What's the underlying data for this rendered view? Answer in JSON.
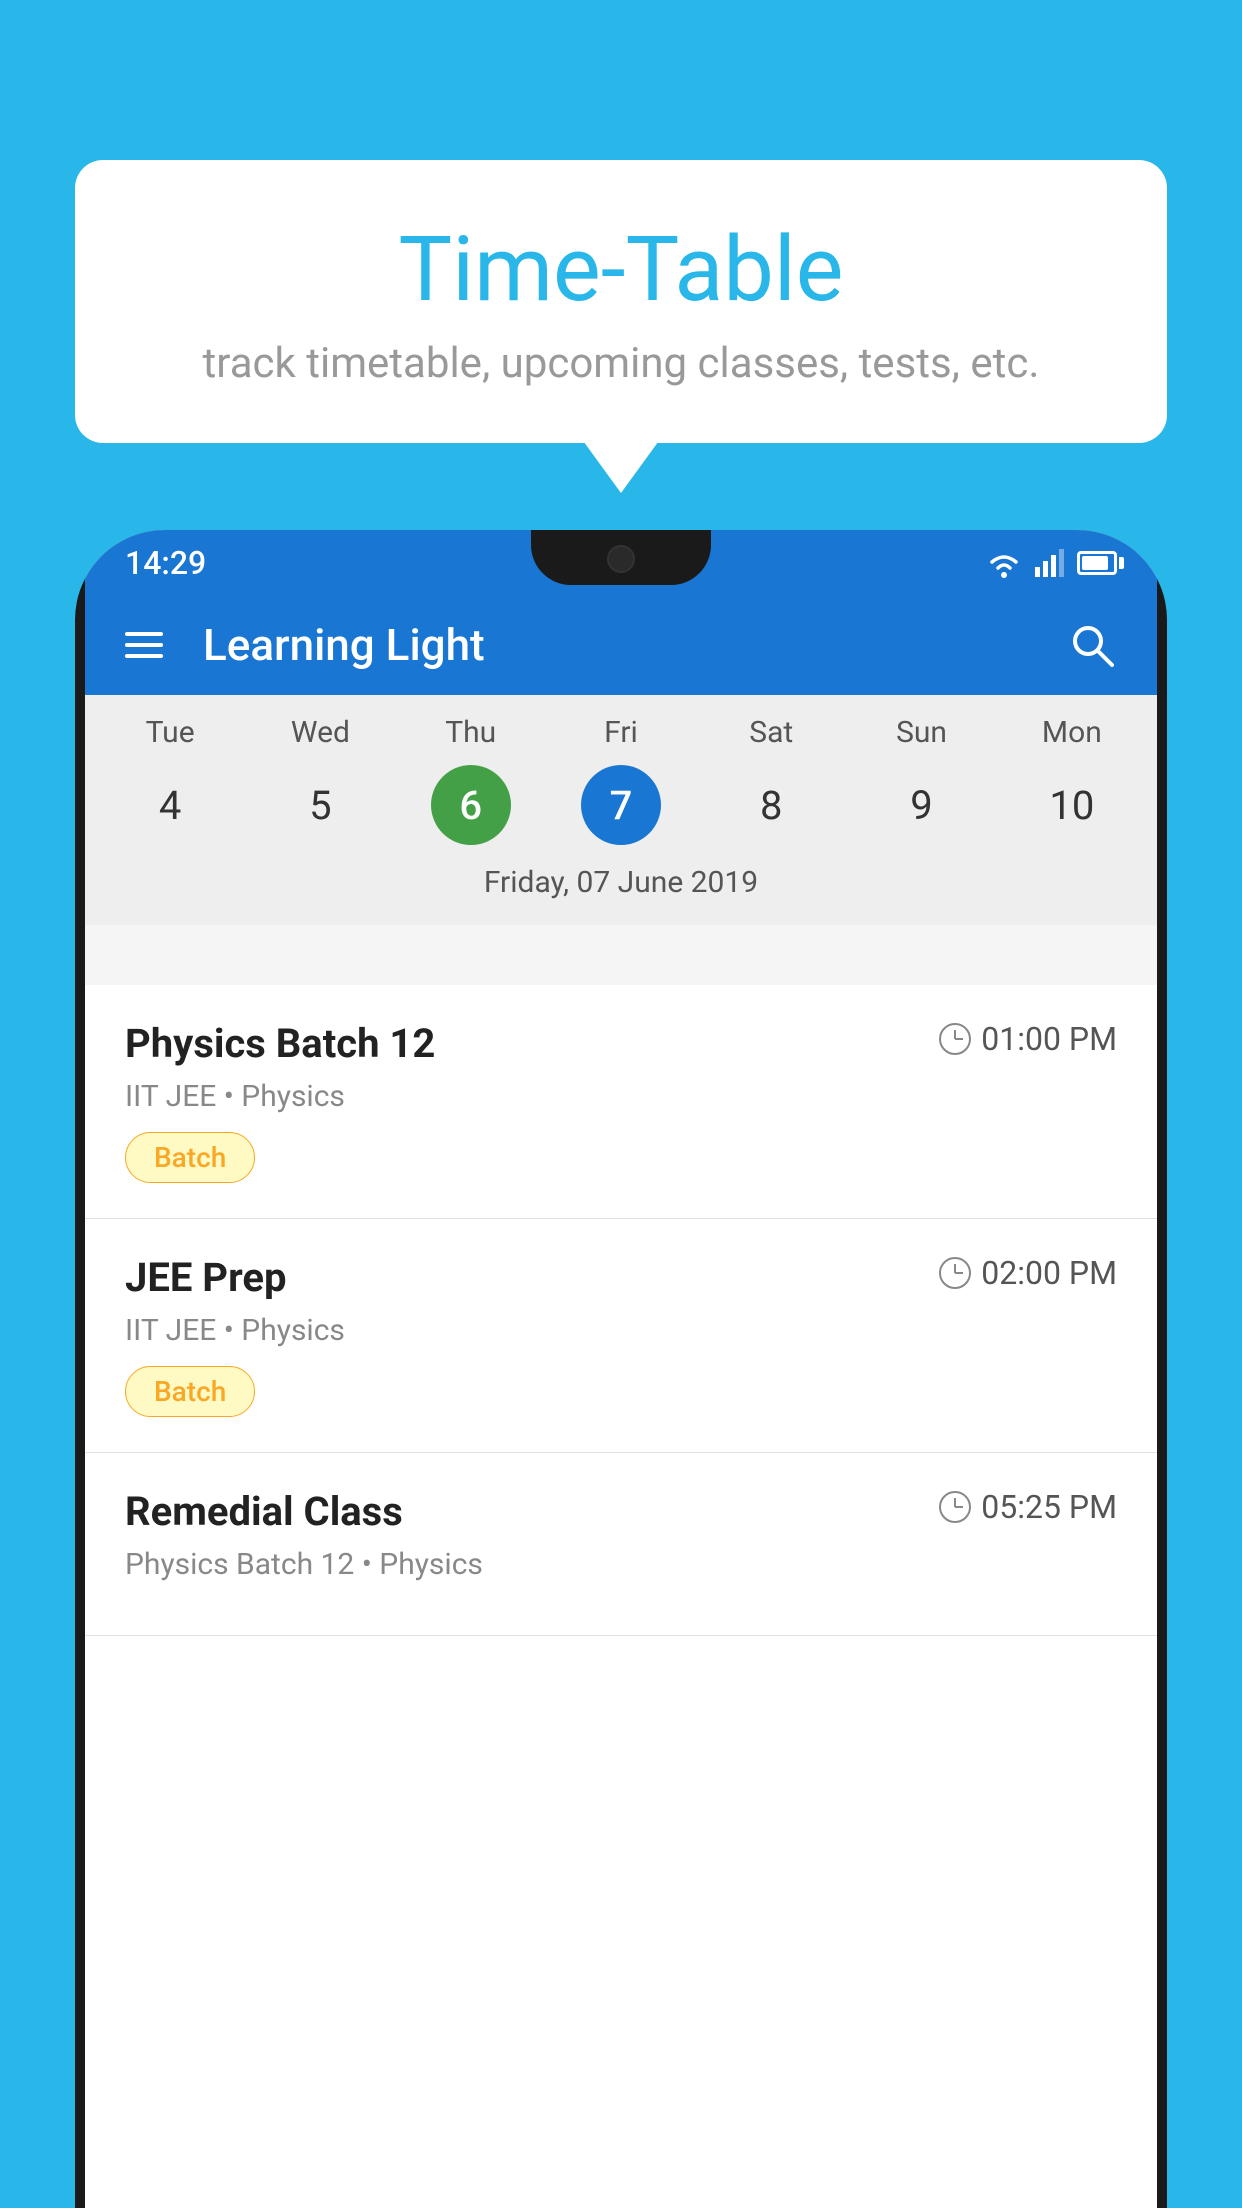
{
  "background_color": "#29B6E8",
  "tooltip": {
    "title": "Time-Table",
    "subtitle": "track timetable, upcoming classes, tests, etc."
  },
  "phone": {
    "status_bar": {
      "time": "14:29"
    },
    "app_bar": {
      "title": "Learning Light"
    },
    "calendar": {
      "day_headers": [
        "Tue",
        "Wed",
        "Thu",
        "Fri",
        "Sat",
        "Sun",
        "Mon"
      ],
      "day_numbers": [
        {
          "num": "4",
          "state": "normal"
        },
        {
          "num": "5",
          "state": "normal"
        },
        {
          "num": "6",
          "state": "today"
        },
        {
          "num": "7",
          "state": "selected"
        },
        {
          "num": "8",
          "state": "normal"
        },
        {
          "num": "9",
          "state": "normal"
        },
        {
          "num": "10",
          "state": "normal"
        }
      ],
      "selected_date": "Friday, 07 June 2019"
    },
    "schedule": {
      "items": [
        {
          "title": "Physics Batch 12",
          "time": "01:00 PM",
          "subtitle": "IIT JEE • Physics",
          "badge": "Batch"
        },
        {
          "title": "JEE Prep",
          "time": "02:00 PM",
          "subtitle": "IIT JEE • Physics",
          "badge": "Batch"
        },
        {
          "title": "Remedial Class",
          "time": "05:25 PM",
          "subtitle": "Physics Batch 12 • Physics",
          "badge": null
        }
      ]
    }
  }
}
